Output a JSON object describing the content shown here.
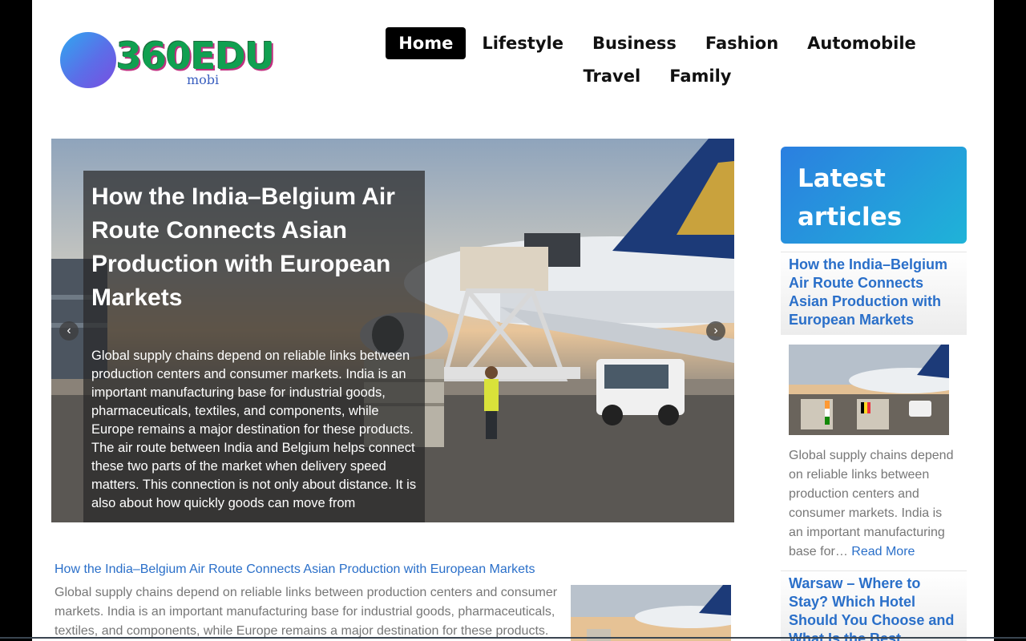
{
  "site": {
    "logo_text": "360EDU",
    "logo_sub": "mobi"
  },
  "nav": {
    "items": [
      "Home",
      "Lifestyle",
      "Business",
      "Fashion",
      "Automobile",
      "Travel",
      "Family"
    ],
    "active": "Home"
  },
  "hero": {
    "title": "How the India–Belgium Air Route Connects Asian Production with European Markets",
    "excerpt": "Global supply chains depend on reliable links between production centers and consumer markets. India is an important manufacturing base for industrial goods, pharmaceuticals, textiles, and components, while Europe remains a major destination for these products. The air route between India and Belgium helps connect these two parts of the market when delivery speed matters. This connection is not only about distance. It is also about how quickly goods can move from",
    "prev_icon": "‹",
    "next_icon": "›"
  },
  "post": {
    "title": "How the India–Belgium Air Route Connects Asian Production with European Markets",
    "excerpt": "Global supply chains depend on reliable links between production centers and consumer markets. India is an important manufacturing base for industrial goods, pharmaceuticals, textiles, and components, while Europe remains a major destination for these products."
  },
  "sidebar": {
    "heading": "Latest articles",
    "article1": {
      "title": "How the India–Belgium Air Route Connects Asian Production with European Markets",
      "excerpt": "Global supply chains depend on reliable links between production centers and consumer markets. India is an important manufacturing base for…",
      "read_more": "Read More"
    },
    "article2": {
      "title": "Warsaw – Where to Stay? Which Hotel Should You Choose and What Is the Best"
    }
  },
  "colors": {
    "link": "#2a6fc9",
    "widget_gradient_start": "#2b7fe0",
    "widget_gradient_end": "#1fb3d8",
    "nav_active_bg": "#000000"
  }
}
